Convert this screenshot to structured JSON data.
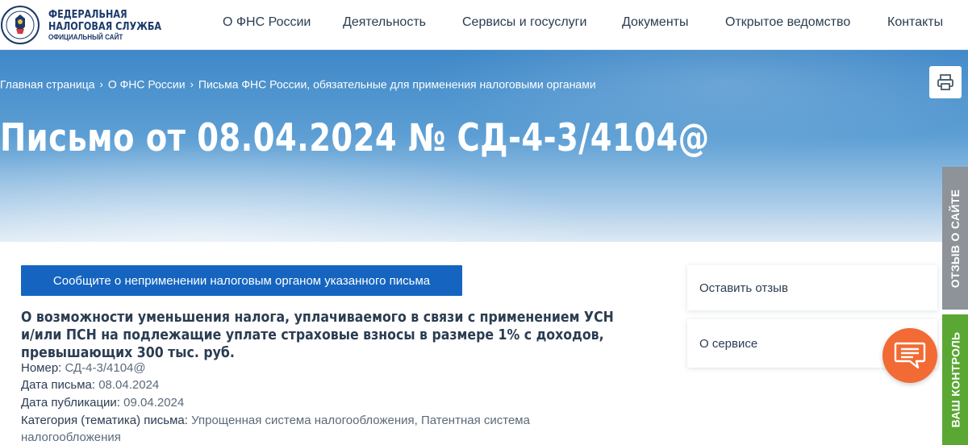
{
  "header": {
    "logo_line1": "ФЕДЕРАЛЬНАЯ",
    "logo_line2": "НАЛОГОВАЯ СЛУЖБА",
    "logo_sub": "ОФИЦИАЛЬНЫЙ САЙТ",
    "nav": [
      "О ФНС России",
      "Деятельность",
      "Сервисы и госуслуги",
      "Документы",
      "Открытое ведомство",
      "Контакты"
    ]
  },
  "breadcrumb": [
    "Главная страница",
    "О ФНС России",
    "Письма ФНС России, обязательные для применения налоговыми органами"
  ],
  "page_title": "Письмо от 08.04.2024 № СД-4-3/4104@",
  "notice_button": "Сообщите о неприменении налоговым органом указанного письма",
  "doc_heading": "О возможности уменьшения налога, уплачиваемого в связи с применением УСН и/или ПСН на подлежащие уплате страховые взносы в размере 1% с доходов, превышающих 300 тыс. руб.",
  "meta": {
    "number_label": "Номер:",
    "number_value": "СД-4-3/4104@",
    "date_label": "Дата письма:",
    "date_value": "08.04.2024",
    "pub_label": "Дата публикации:",
    "pub_value": "09.04.2024",
    "category_label": "Категория (тематика) письма:",
    "category_value_line1": "Упрощенная система налогообложения, Патентная система",
    "category_value_line2": "налогообложения"
  },
  "side": {
    "feedback": "Оставить отзыв",
    "service": "О сервисе"
  },
  "vertical_tabs": {
    "feedback": "ОТЗЫВ О САЙТЕ",
    "control": "ВАШ КОНТРОЛЬ"
  },
  "colors": {
    "primary_button": "#1565c0",
    "chat_button": "#f26a34",
    "feedback_tab": "#8d9399",
    "control_tab": "#5aa833"
  }
}
